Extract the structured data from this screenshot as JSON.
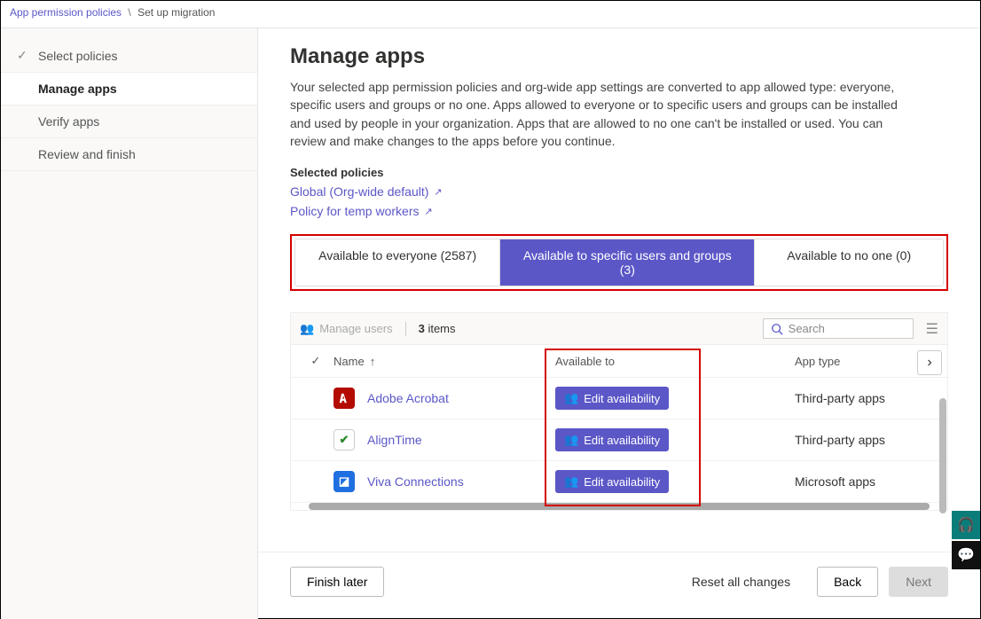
{
  "breadcrumb": {
    "parent": "App permission policies",
    "current": "Set up migration"
  },
  "sidebar": {
    "items": [
      {
        "label": "Select policies",
        "state": "done"
      },
      {
        "label": "Manage apps",
        "state": "active"
      },
      {
        "label": "Verify apps",
        "state": ""
      },
      {
        "label": "Review and finish",
        "state": ""
      }
    ]
  },
  "main": {
    "title": "Manage apps",
    "description": "Your selected app permission policies and org-wide app settings are converted to app allowed type: everyone, specific users and groups or no one. Apps allowed to everyone or to specific users and groups can be installed and used by people in your organization. Apps that are allowed to no one can't be installed or used. You can review and make changes to the apps before you continue.",
    "selected_policies_label": "Selected policies",
    "policies": [
      {
        "label": "Global (Org-wide default)"
      },
      {
        "label": "Policy for temp workers"
      }
    ],
    "tabs": [
      {
        "label": "Available to everyone (2587)",
        "active": false
      },
      {
        "label": "Available to specific users and groups (3)",
        "active": true
      },
      {
        "label": "Available to no one (0)",
        "active": false
      }
    ],
    "toolbar": {
      "manage_users": "Manage users",
      "count_num": "3",
      "count_word": "items",
      "search_placeholder": "Search"
    },
    "columns": {
      "name": "Name",
      "available": "Available to",
      "type": "App type"
    },
    "rows": [
      {
        "name": "Adobe Acrobat",
        "type": "Third-party apps",
        "icon_bg": "#b30b00",
        "icon_fg": "#fff",
        "icon_txt": "A"
      },
      {
        "name": "AlignTime",
        "type": "Third-party apps",
        "icon_bg": "#fff",
        "icon_fg": "#2a8a2a",
        "icon_txt": "✓",
        "icon_border": "#ccc"
      },
      {
        "name": "Viva Connections",
        "type": "Microsoft apps",
        "icon_bg": "#1f6fe0",
        "icon_fg": "#fff",
        "icon_txt": "▘"
      }
    ],
    "edit_label": "Edit availability"
  },
  "footer": {
    "finish_later": "Finish later",
    "reset": "Reset all changes",
    "back": "Back",
    "next": "Next"
  }
}
